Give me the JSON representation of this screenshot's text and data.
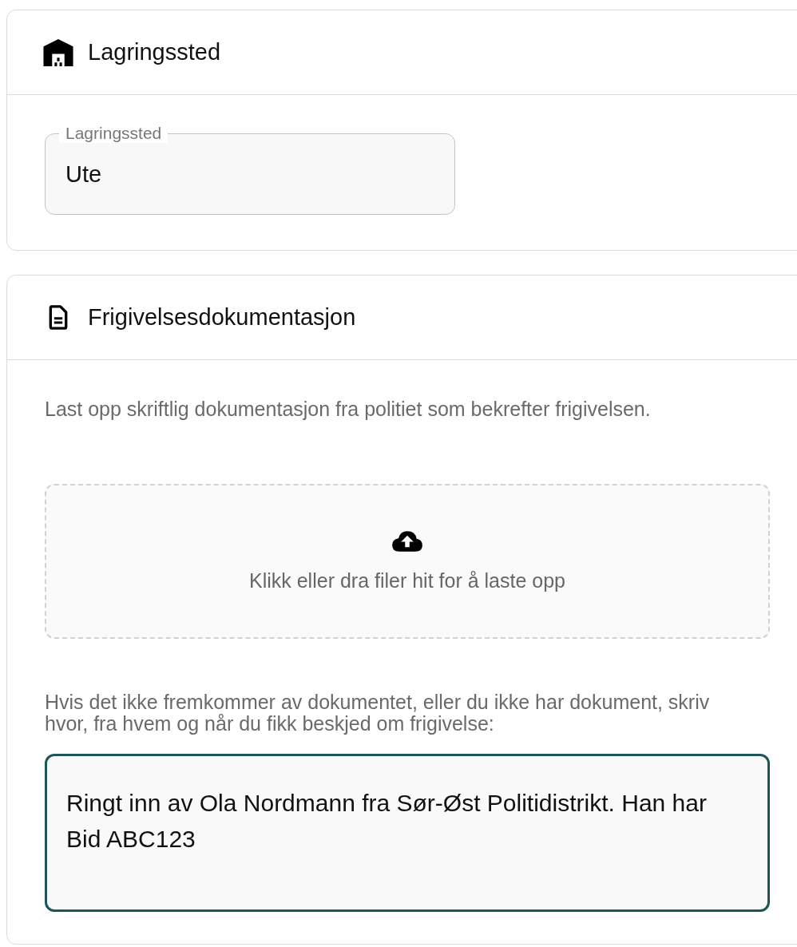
{
  "sections": [
    {
      "title": "Lagringssted",
      "kind": "field",
      "field": {
        "label": "Lagringssted",
        "value": "Ute"
      }
    },
    {
      "title": "Frigivelsesdokumentasjon",
      "kind": "upload",
      "description": "Last opp skriftlig dokumentasjon fra politiet som bekrefter frigivelsen.",
      "dropzone": {
        "text": "Klikk eller dra filer hit for å laste opp"
      },
      "note": "Hvis det ikke fremkommer av dokumentet, eller du ikke har dokument, skriv hvor, fra hvem og når du fikk beskjed om frigivelse:",
      "textarea": {
        "value": "Ringt inn av Ola Nordmann fra Sør-Øst Politidistrikt. Han har Bid ABC123",
        "focused": true
      }
    }
  ]
}
